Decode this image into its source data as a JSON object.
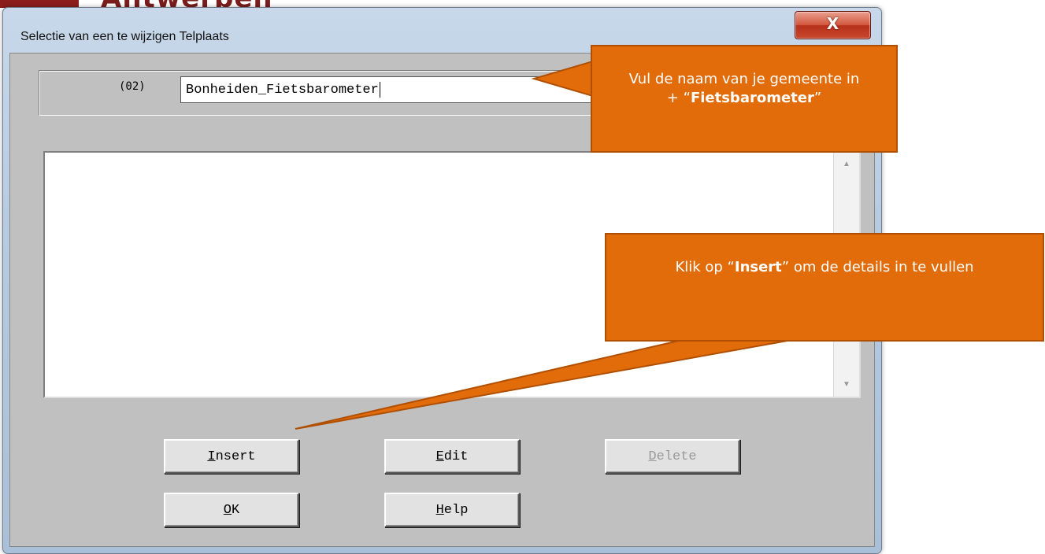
{
  "background": {
    "header_text": "Antwerpen"
  },
  "window": {
    "title": "Selectie van een te wijzigen Telplaats",
    "close_label": "X"
  },
  "form": {
    "field_code": "(02)",
    "name_value": "Bonheiden_Fietsbarometer"
  },
  "list": {
    "items": []
  },
  "buttons": {
    "insert": {
      "accel": "I",
      "rest": "nsert"
    },
    "edit": {
      "accel": "E",
      "rest": "dit"
    },
    "delete": {
      "accel": "D",
      "rest": "elete",
      "disabled": true
    },
    "ok": {
      "accel": "O",
      "rest": "K"
    },
    "help": {
      "accel": "H",
      "rest": "elp"
    }
  },
  "callouts": {
    "name": {
      "line1": "Vul de naam van je gemeente in",
      "prefix": "+ “",
      "bold": "Fietsbarometer",
      "suffix": "”"
    },
    "insert": {
      "prefix": "Klik op “",
      "bold": "Insert",
      "suffix": "” om de details in te vullen"
    }
  },
  "colors": {
    "callout": "#e36c0a",
    "dialog_face": "#c0c0c0"
  }
}
